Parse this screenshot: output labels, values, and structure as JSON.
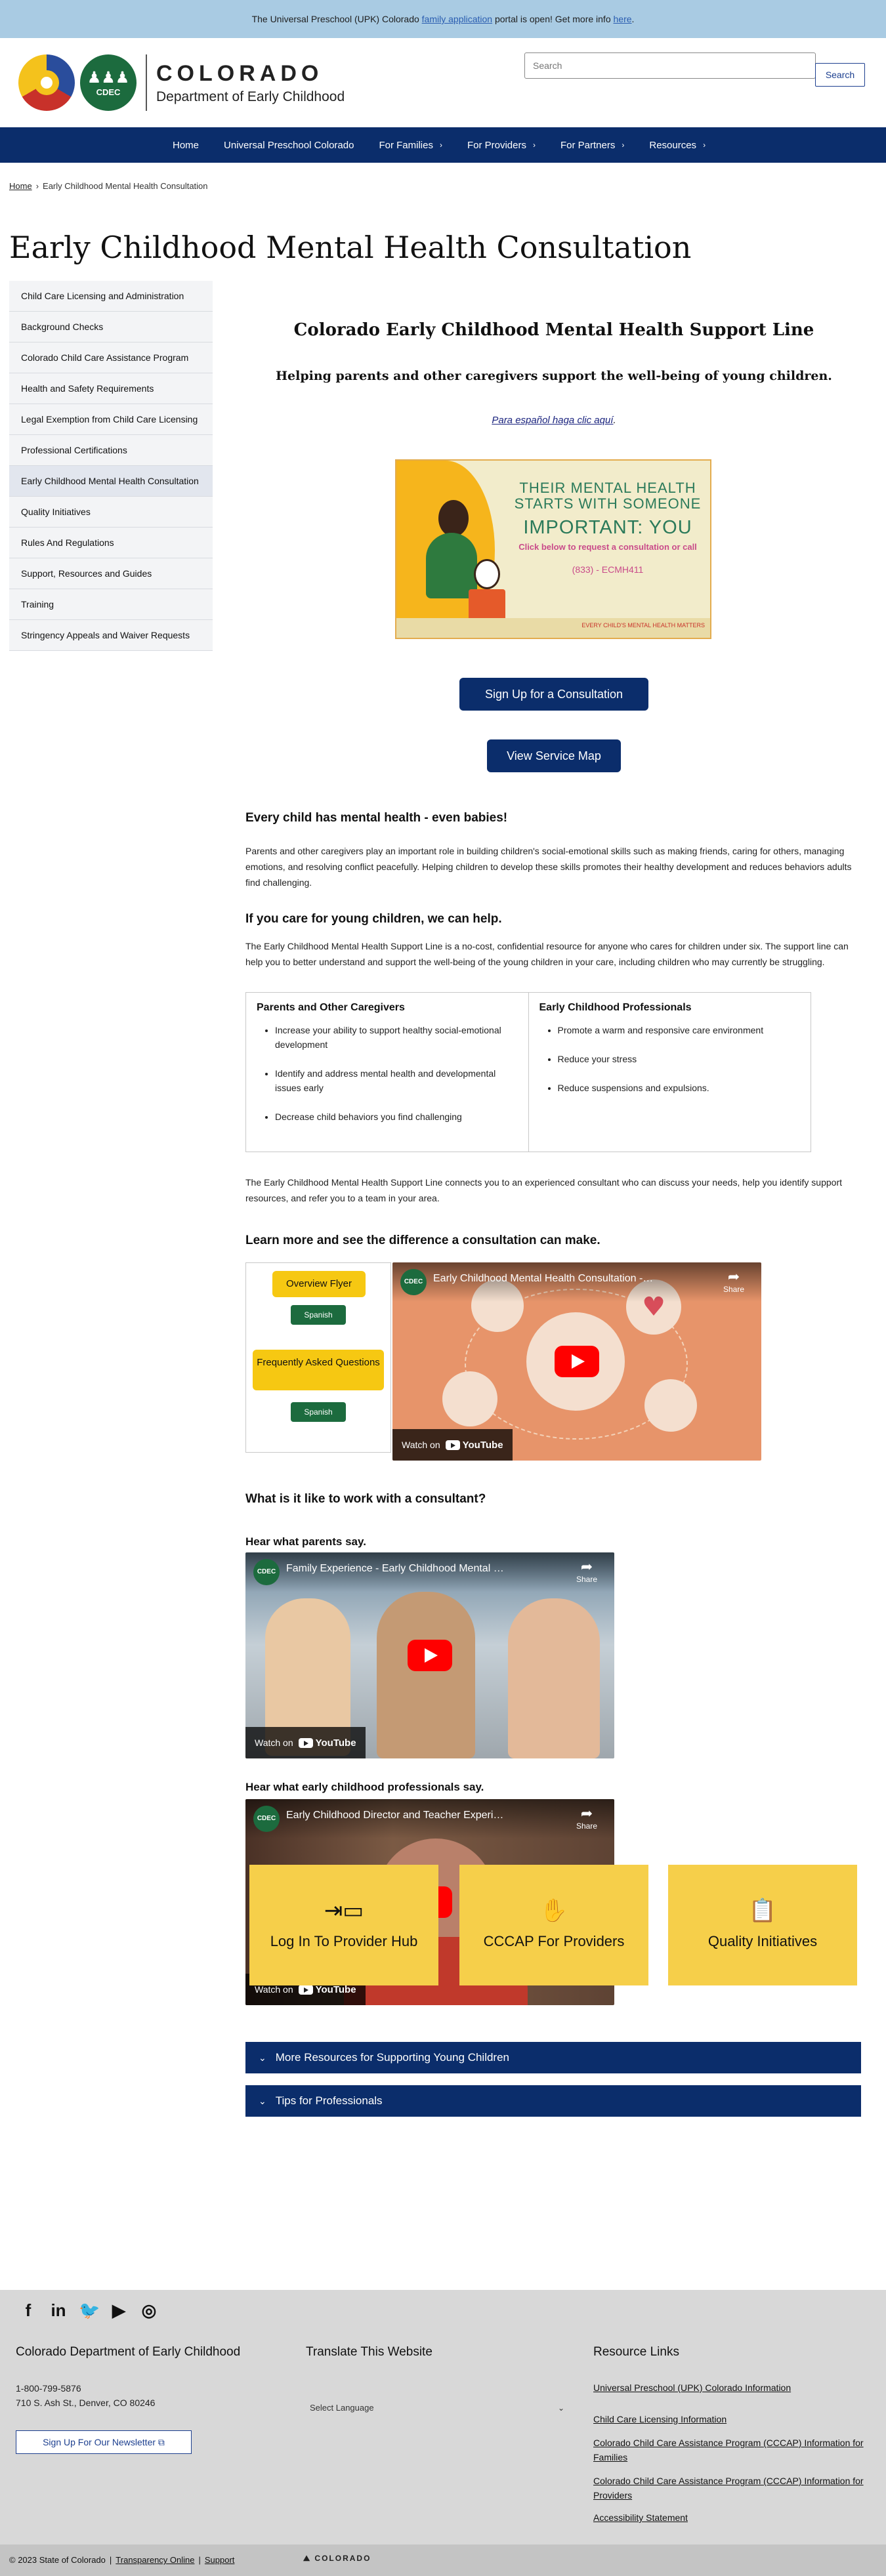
{
  "alert": {
    "prefix": "The Universal Preschool (UPK) Colorado ",
    "link1": "family application",
    "middle": " portal is open! Get more info ",
    "link2": "here",
    "suffix": "."
  },
  "header": {
    "logo_cdec_text": "CDEC",
    "brand_name": "COLORADO",
    "brand_dept": "Department of Early Childhood",
    "search_placeholder": "Search",
    "search_button": "Search"
  },
  "nav": {
    "items": [
      {
        "label": "Home",
        "has_menu": false
      },
      {
        "label": "Universal Preschool Colorado",
        "has_menu": false
      },
      {
        "label": "For Families",
        "has_menu": true
      },
      {
        "label": "For Providers",
        "has_menu": true
      },
      {
        "label": "For Partners",
        "has_menu": true
      },
      {
        "label": "Resources",
        "has_menu": true
      }
    ]
  },
  "breadcrumb": {
    "home": "Home",
    "separator": "›",
    "current": "Early Childhood Mental Health Consultation"
  },
  "page_title": "Early Childhood Mental Health Consultation",
  "sidebar": {
    "items": [
      "Child Care Licensing and Administration",
      "Background Checks",
      "Colorado Child Care Assistance Program",
      "Health and Safety Requirements",
      "Legal Exemption from Child Care Licensing",
      "Professional Certifications",
      "Early Childhood Mental Health Consultation",
      "Quality Initiatives",
      "Rules And Regulations",
      "Support, Resources and Guides",
      "Training",
      "Stringency Appeals and Waiver Requests"
    ],
    "active_index": 6
  },
  "main": {
    "support_title": "Colorado Early Childhood Mental Health Support Line",
    "support_subtitle": "Helping parents and other caregivers support the well-being of young children.",
    "espanol_link": "Para español haga clic aquí",
    "espanol_suffix": ".",
    "banner": {
      "line1": "THEIR MENTAL HEALTH STARTS WITH SOMEONE",
      "line2": "IMPORTANT: YOU",
      "line3": "Click below to request a consultation or call",
      "line4": "(833) - ECMH411",
      "footer": "EVERY CHILD'S MENTAL HEALTH MATTERS"
    },
    "signup_button": "Sign Up for a Consultation",
    "map_button": "View Service Map",
    "h_every_child": "Every child has mental health - even babies!",
    "p_every_child": "Parents and other caregivers play an important role in building children's social-emotional skills such as making friends, caring for others, managing emotions, and resolving conflict peacefully. Helping children to develop these skills promotes their healthy development and reduces behaviors adults find challenging.",
    "h_if_you_care": "If you care for young children, we can help.",
    "p_if_you_care": "The Early Childhood Mental Health Support Line is a no-cost, confidential resource for anyone who cares for children under six. The support line can help you to better understand and support the well-being of the young children in your care, including children who may currently be struggling.",
    "columns": [
      {
        "title": "Parents and Other Caregivers",
        "items": [
          "Increase your ability to support  healthy social-emotional development",
          "Identify and address mental health and developmental issues early",
          "Decrease child behaviors you find challenging"
        ]
      },
      {
        "title": "Early Childhood Professionals",
        "items": [
          "Promote a warm and responsive care environment",
          "Reduce your stress",
          "Reduce suspensions and expulsions."
        ]
      }
    ],
    "p_connects": "The Early Childhood Mental Health Support Line connects you to an experienced consultant who can discuss your needs, help you identify support resources, and refer you to a team in your area.",
    "h_learn_more": "Learn more and see the difference a consultation can make.",
    "flyer_button": "Overview Flyer",
    "faq_button": "Frequently Asked Questions",
    "spanish_label": "Spanish",
    "video_main": {
      "title": "Early Childhood Mental Health Consultation - The ...",
      "channel": "CDEC"
    },
    "h_what_like": "What is it like to work with a consultant?",
    "h_parents_say": "Hear what parents say.",
    "video_parents": {
      "title": "Family Experience - Early Childhood Mental Health ...",
      "channel": "CDEC"
    },
    "h_professionals_say": "Hear what early childhood professionals say.",
    "video_professionals": {
      "title": "Early Childhood Director and Teacher Experience - ...",
      "channel": "CDEC"
    },
    "video_share": "Share",
    "video_watch_on": "Watch on",
    "video_youtube": "YouTube",
    "accordion_resources": "More Resources for Supporting Young Children",
    "accordion_tips": "Tips for Professionals",
    "tiles": [
      {
        "label": "Log In To Provider Hub",
        "icon": "login-icon"
      },
      {
        "label": "CCCAP For Providers",
        "icon": "hand-coin-icon"
      },
      {
        "label": "Quality Initiatives",
        "icon": "clipboard-check-icon"
      }
    ]
  },
  "footer": {
    "social": [
      "facebook-icon",
      "linkedin-icon",
      "twitter-icon",
      "youtube-icon",
      "instagram-icon"
    ],
    "org_title": "Colorado Department of Early Childhood",
    "phone": "1-800-799-5876",
    "address": "710 S. Ash St., Denver, CO 80246",
    "newsletter": "Sign Up For Our Newsletter",
    "translate_title": "Translate This Website",
    "language_select": "Select Language",
    "resource_title": "Resource Links",
    "resource_links": [
      "Universal Preschool (UPK) Colorado Information",
      "Child Care Licensing Information",
      "Colorado Child Care Assistance Program (CCCAP) Information for Families",
      "Colorado Child Care Assistance Program (CCCAP) Information for Providers",
      "Accessibility Statement"
    ],
    "copyright": "© 2023 State of Colorado",
    "transparency": "Transparency Online",
    "support": "Support",
    "co_mark": "COLORADO"
  }
}
